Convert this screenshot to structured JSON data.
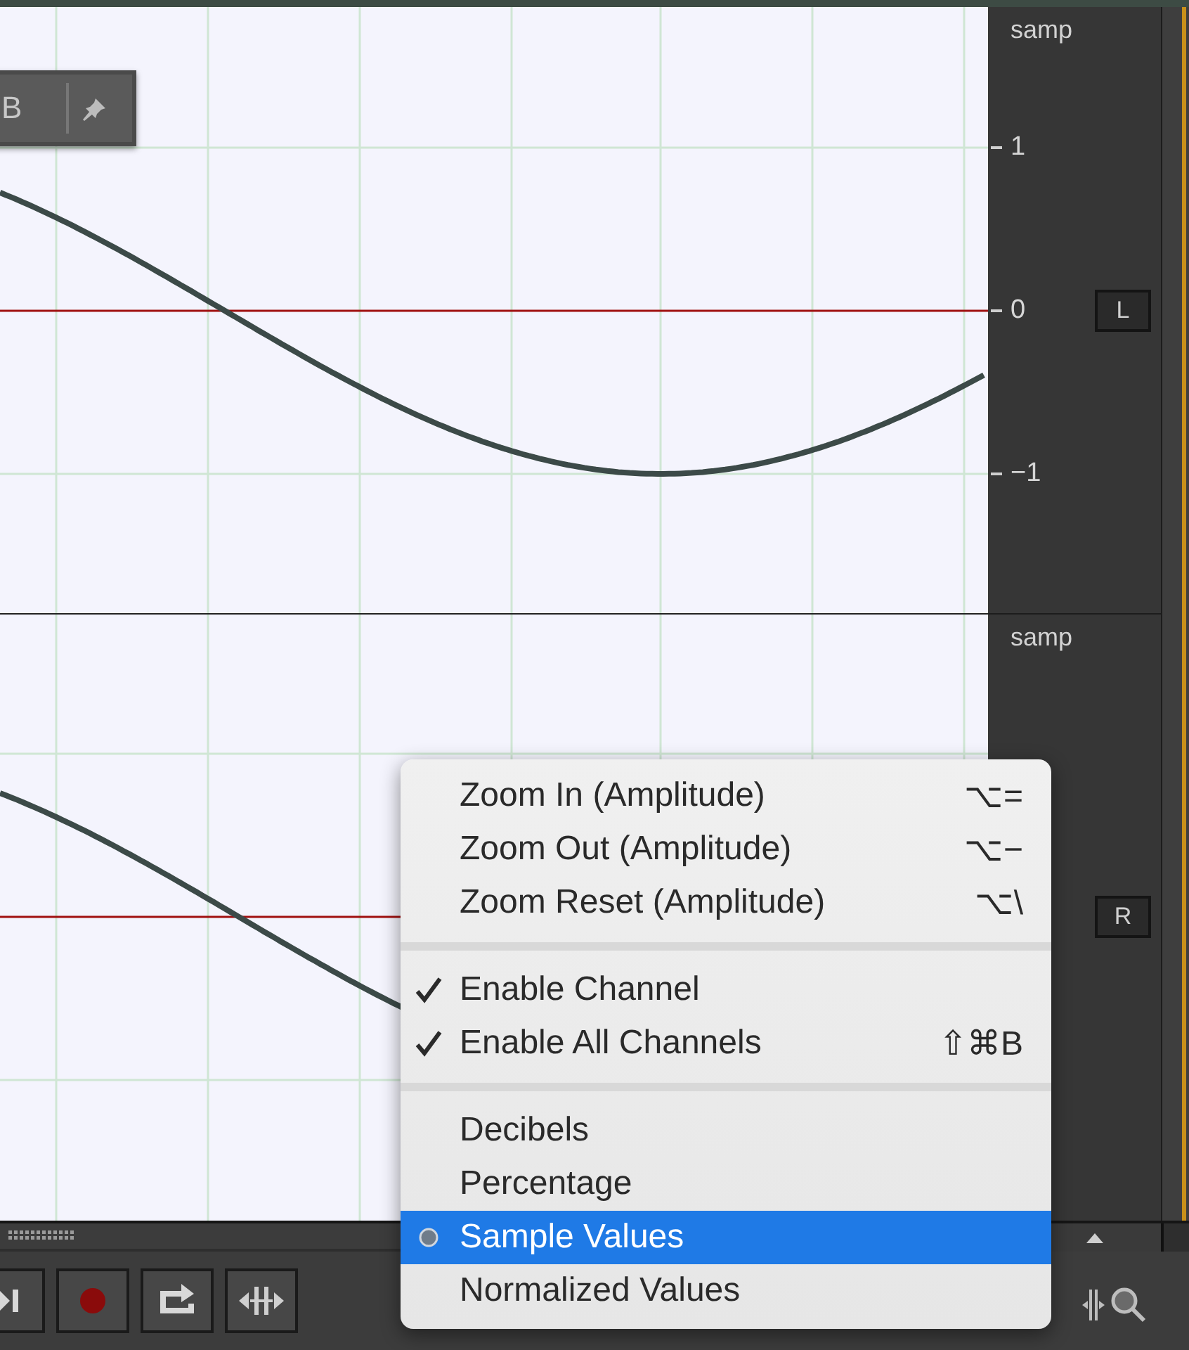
{
  "hud": {
    "label": "B"
  },
  "channels": [
    {
      "unit": "samp",
      "button": "L",
      "ticks": [
        "1",
        "0",
        "−1"
      ]
    },
    {
      "unit": "samp",
      "button": "R"
    }
  ],
  "context_menu": {
    "items": [
      {
        "kind": "command",
        "label": "Zoom In (Amplitude)",
        "shortcut": "⌥="
      },
      {
        "kind": "command",
        "label": "Zoom Out (Amplitude)",
        "shortcut": "⌥−"
      },
      {
        "kind": "command",
        "label": "Zoom Reset (Amplitude)",
        "shortcut": "⌥\\"
      },
      {
        "kind": "separator"
      },
      {
        "kind": "toggle",
        "label": "Enable Channel",
        "checked": true
      },
      {
        "kind": "toggle",
        "label": "Enable All Channels",
        "checked": true,
        "shortcut": "⇧⌘B"
      },
      {
        "kind": "separator"
      },
      {
        "kind": "radio",
        "label": "Decibels",
        "selected": false
      },
      {
        "kind": "radio",
        "label": "Percentage",
        "selected": false
      },
      {
        "kind": "radio",
        "label": "Sample Values",
        "selected": true
      },
      {
        "kind": "radio",
        "label": "Normalized Values",
        "selected": false
      }
    ]
  }
}
